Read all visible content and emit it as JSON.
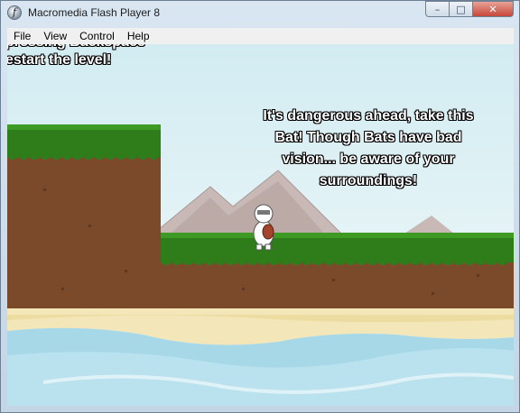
{
  "window": {
    "title": "Macromedia Flash Player 8"
  },
  "menu": {
    "items": [
      {
        "label": "File"
      },
      {
        "label": "View"
      },
      {
        "label": "Control"
      },
      {
        "label": "Help"
      }
    ]
  },
  "game": {
    "hud_line_top": "pressing Backspace",
    "hud_line_bottom": "estart the level!",
    "dialog_lines": [
      "It's dangerous ahead, take this",
      "Bat! Though Bats have bad",
      "vision... be aware of your",
      "surroundings!"
    ]
  },
  "colors": {
    "grass": "#2f7d1a",
    "dirt": "#7a4a2a",
    "sand": "#f3e6b8",
    "water": "#a6d8e8"
  }
}
